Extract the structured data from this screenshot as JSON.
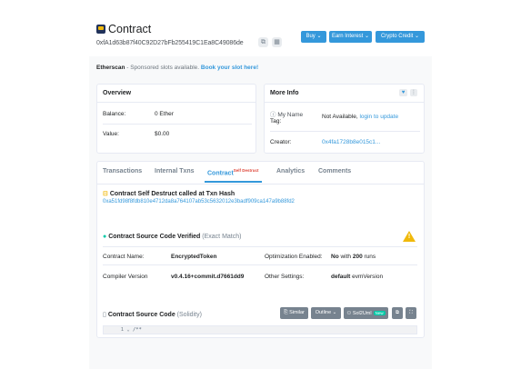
{
  "header": {
    "title": "Contract",
    "address": "0xfA1d63b87f40C92D27bFb255419C1Ea8C49086de",
    "buttons": [
      {
        "label": "Buy",
        "color": "#3498db"
      },
      {
        "label": "Earn Interest",
        "color": "#3498db"
      },
      {
        "label": "Crypto Credit",
        "color": "#3498db"
      }
    ]
  },
  "sponsor": {
    "brand": "Etherscan",
    "text": " - Sponsored slots available. ",
    "link": "Book your slot here!"
  },
  "overview": {
    "title": "Overview",
    "rows": [
      {
        "label": "Balance:",
        "value": "0 Ether"
      },
      {
        "label": "Value:",
        "value": "$0.00"
      }
    ]
  },
  "more_info": {
    "title": "More Info",
    "name_tag_label_1": "My Name",
    "name_tag_label_2": "Tag:",
    "name_tag_value": "Not Available, ",
    "name_tag_link": "login to update",
    "creator_label": "Creator:",
    "creator_value": "0x4fa1728b8e015c1..."
  },
  "tabs": [
    {
      "label": "Transactions"
    },
    {
      "label": "Internal Txns"
    },
    {
      "label": "Contract",
      "badge": "Self Destruct",
      "active": true
    },
    {
      "label": "Analytics"
    },
    {
      "label": "Comments"
    }
  ],
  "self_destruct": {
    "title": "Contract Self Destruct called at Txn Hash",
    "hash": "0xa51fd98f8fdb810e4712da8a764107ab53c5632012e3badf909ca147a9b88fd2"
  },
  "verified": {
    "title": "Contract Source Code Verified",
    "subtitle": "(Exact Match)",
    "rows": [
      {
        "label": "Contract Name:",
        "value": "EncryptedToken",
        "label2": "Optimization Enabled:",
        "value2_bold": "No",
        "value2_rest": " with ",
        "value2_runs": "200",
        "value2_tail": " runs"
      },
      {
        "label": "Compiler Version",
        "value": "v0.4.16+commit.d7661dd9",
        "label2": "Other Settings:",
        "value2_bold": "default",
        "value2_rest": " evmVersion"
      }
    ]
  },
  "source": {
    "title": "Contract Source Code",
    "subtitle": "(Solidity)",
    "buttons": {
      "similar": "Similar",
      "outline": "Outline",
      "sol2uml": "Sol2Uml",
      "sol2uml_badge": "New"
    },
    "code_line_number": "1",
    "code_line_text": "/**"
  }
}
